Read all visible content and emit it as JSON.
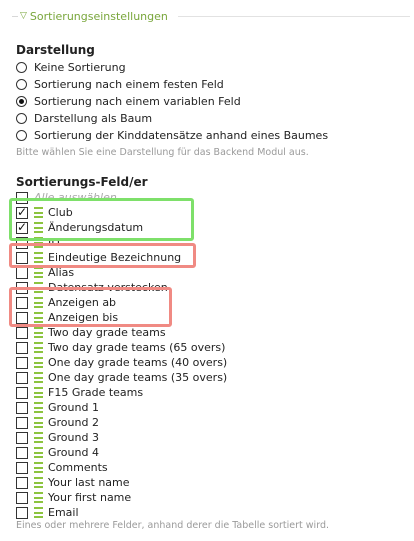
{
  "section": {
    "legend": "Sortierungseinstellungen"
  },
  "display": {
    "heading": "Darstellung",
    "options": [
      {
        "label": "Keine Sortierung",
        "checked": false
      },
      {
        "label": "Sortierung nach einem festen Feld",
        "checked": false
      },
      {
        "label": "Sortierung nach einem variablen Feld",
        "checked": true
      },
      {
        "label": "Darstellung als Baum",
        "checked": false
      },
      {
        "label": "Sortierung der Kinddatensätze anhand eines Baumes",
        "checked": false
      }
    ],
    "hint": "Bitte wählen Sie eine Darstellung für das Backend Modul aus."
  },
  "fields": {
    "heading": "Sortierungs-Feld/er",
    "select_all": "Alle auswählen",
    "items": [
      {
        "label": "Club",
        "checked": true
      },
      {
        "label": "Änderungsdatum",
        "checked": true
      },
      {
        "label": "ID",
        "checked": false
      },
      {
        "label": "Eindeutige Bezeichnung",
        "checked": false
      },
      {
        "label": "Alias",
        "checked": false
      },
      {
        "label": "Datensatz verstecken",
        "checked": false
      },
      {
        "label": "Anzeigen ab",
        "checked": false
      },
      {
        "label": "Anzeigen bis",
        "checked": false
      },
      {
        "label": "Two day grade teams",
        "checked": false
      },
      {
        "label": "Two day grade teams (65 overs)",
        "checked": false
      },
      {
        "label": "One day grade teams (40 overs)",
        "checked": false
      },
      {
        "label": "One day grade teams (35 overs)",
        "checked": false
      },
      {
        "label": "F15 Grade teams",
        "checked": false
      },
      {
        "label": "Ground 1",
        "checked": false
      },
      {
        "label": "Ground 2",
        "checked": false
      },
      {
        "label": "Ground 3",
        "checked": false
      },
      {
        "label": "Ground 4",
        "checked": false
      },
      {
        "label": "Comments",
        "checked": false
      },
      {
        "label": "Your last name",
        "checked": false
      },
      {
        "label": "Your first name",
        "checked": false
      },
      {
        "label": "Email",
        "checked": false
      }
    ],
    "hint": "Eines oder mehrere Felder, anhand derer die Tabelle sortiert wird."
  },
  "colors": {
    "accent": "#79a63b",
    "drag_handle": "#8cc43f",
    "highlight_green": "#7ee06a",
    "highlight_red": "#f08a83"
  }
}
